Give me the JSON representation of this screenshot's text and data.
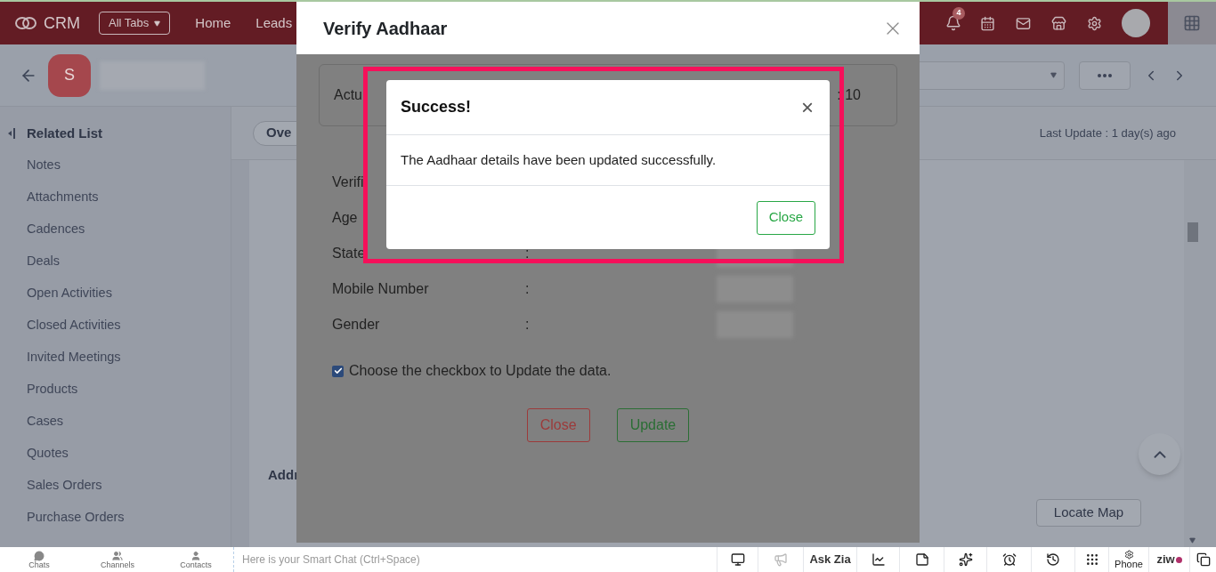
{
  "topbar": {
    "brand": "CRM",
    "all_tabs": "All Tabs",
    "nav": [
      "Home",
      "Leads"
    ],
    "notifications_badge": "4"
  },
  "record_header": {
    "avatar_letter": "S"
  },
  "sidebar": {
    "title": "Related List",
    "items": [
      "Notes",
      "Attachments",
      "Cadences",
      "Deals",
      "Open Activities",
      "Closed Activities",
      "Invited Meetings",
      "Products",
      "Cases",
      "Quotes",
      "Sales Orders",
      "Purchase Orders"
    ]
  },
  "content": {
    "tab": "Ove",
    "last_update": "Last Update : 1 day(s) ago",
    "section_title": "Addr",
    "locate_map": "Locate Map"
  },
  "verify_modal": {
    "title": "Verify Aadhaar",
    "summary_left": "Actu",
    "summary_right": ": 10",
    "rows": [
      {
        "label": "Verifi",
        "blurred": false
      },
      {
        "label": "Age",
        "blurred": false
      },
      {
        "label": "State",
        "colon": ":",
        "blurred": true
      },
      {
        "label": "Mobile Number",
        "colon": ":",
        "blurred": true
      },
      {
        "label": "Gender",
        "colon": ":",
        "blurred": true
      }
    ],
    "checkbox": {
      "label": "Choose the checkbox to Update the data.",
      "checked": true
    },
    "buttons": [
      {
        "label": "Close",
        "kind": "danger"
      },
      {
        "label": "Update",
        "kind": "success"
      }
    ]
  },
  "success_dialog": {
    "title": "Success!",
    "close_glyph": "×",
    "message": "The Aadhaar details have been updated successfully.",
    "button": "Close",
    "highlighted": true
  },
  "bottom_bar": {
    "apps": [
      "Chats",
      "Channels",
      "Contacts"
    ],
    "smart_chat_placeholder": "Here is your Smart Chat (Ctrl+Space)",
    "tools": [
      {
        "kind": "icon",
        "disabled": false
      },
      {
        "kind": "icon",
        "disabled": true
      },
      {
        "kind": "label",
        "label": "Ask Zia",
        "disabled": false
      },
      {
        "kind": "icon",
        "disabled": false
      },
      {
        "kind": "icon",
        "disabled": false
      },
      {
        "kind": "icon",
        "disabled": false
      },
      {
        "kind": "icon",
        "disabled": false
      },
      {
        "kind": "icon",
        "disabled": false
      },
      {
        "kind": "icon",
        "disabled": false
      },
      {
        "kind": "icon_label",
        "label": "Phone",
        "disabled": false
      },
      {
        "kind": "logo",
        "label": "ziw",
        "disabled": false
      },
      {
        "kind": "icon",
        "disabled": false
      }
    ]
  }
}
